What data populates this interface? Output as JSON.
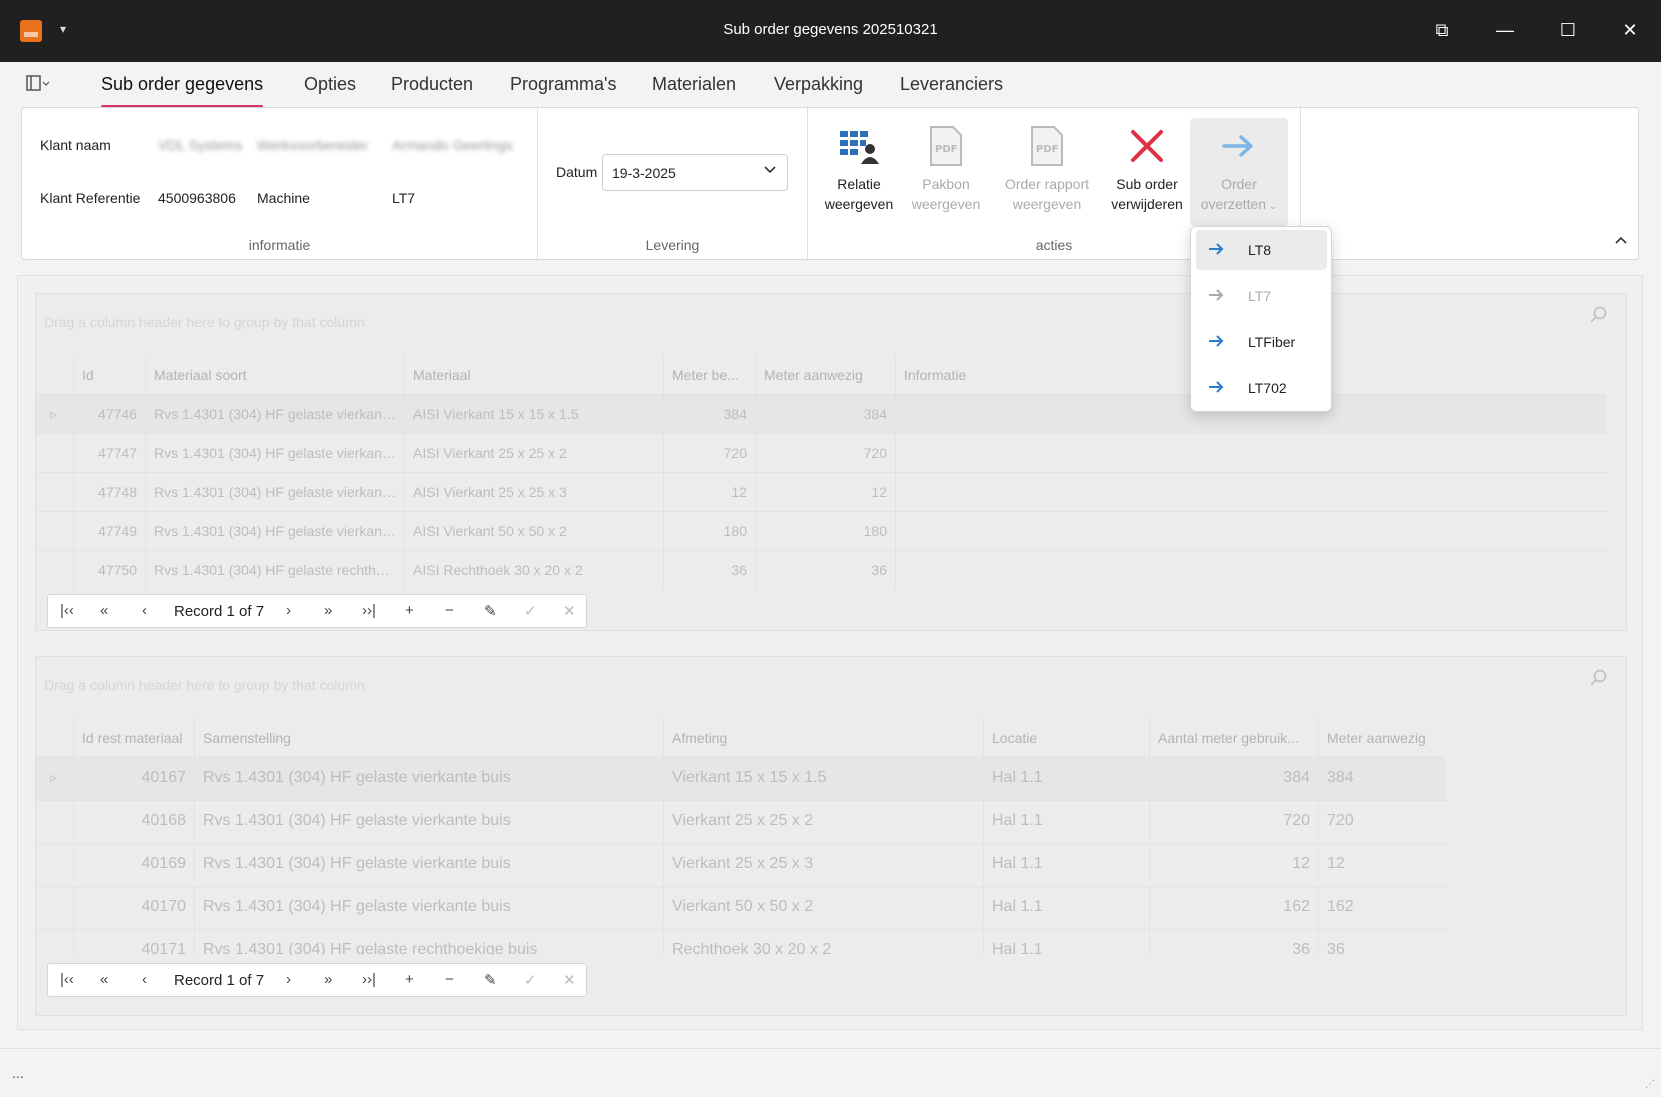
{
  "window": {
    "title": "Sub order gegevens 202510321",
    "quick_access": "▾",
    "btn_restore": "⧉",
    "btn_min": "—",
    "btn_max": "☐",
    "btn_close": "✕"
  },
  "tabs": [
    {
      "label": "Sub order gegevens"
    },
    {
      "label": "Opties"
    },
    {
      "label": "Producten"
    },
    {
      "label": "Programma's"
    },
    {
      "label": "Materialen"
    },
    {
      "label": "Verpakking"
    },
    {
      "label": "Leveranciers"
    }
  ],
  "ribbon": {
    "info": {
      "caption": "informatie",
      "klant_naam_label": "Klant naam",
      "klant_naam_blur1": "VDL Systems",
      "klant_naam_blur2": "Werkvoorbereider",
      "klant_naam_blur3": "Armando Geerlings",
      "klant_ref_label": "Klant Referentie",
      "klant_ref_value": "4500963806",
      "machine_label": "Machine",
      "machine_value": "LT7"
    },
    "levering": {
      "caption": "Levering",
      "datum_label": "Datum",
      "datum_value": "19-3-2025"
    },
    "acties": {
      "caption": "acties",
      "relatie": [
        "Relatie",
        "weergeven"
      ],
      "pakbon": [
        "Pakbon",
        "weergeven"
      ],
      "rapport": [
        "Order rapport",
        "weergeven"
      ],
      "verwijderen": [
        "Sub order",
        "verwijderen"
      ],
      "overzetten": [
        "Order",
        "overzetten"
      ]
    }
  },
  "dropdown": {
    "items": [
      {
        "label": "LT8"
      },
      {
        "label": "LT7"
      },
      {
        "label": "LTFiber"
      },
      {
        "label": "LT702"
      }
    ]
  },
  "grid1": {
    "group_hint": "Drag a column header here to group by that column",
    "columns": [
      "Id",
      "Materiaal soort",
      "Materiaal",
      "Meter be...",
      "Meter aanwezig",
      "Informatie"
    ],
    "rows": [
      [
        "47746",
        "Rvs 1.4301 (304) HF gelaste vierkante ...",
        "AISI Vierkant 15 x 15 x 1.5",
        "384",
        "384",
        ""
      ],
      [
        "47747",
        "Rvs 1.4301 (304) HF gelaste vierkante ...",
        "AISI Vierkant 25 x 25 x 2",
        "720",
        "720",
        ""
      ],
      [
        "47748",
        "Rvs 1.4301 (304) HF gelaste vierkante ...",
        "AISI Vierkant 25 x 25 x 3",
        "12",
        "12",
        ""
      ],
      [
        "47749",
        "Rvs 1.4301 (304) HF gelaste vierkante ...",
        "AISI Vierkant 50 x 50 x 2",
        "180",
        "180",
        ""
      ],
      [
        "47750",
        "Rvs 1.4301 (304) HF gelaste rechthoeki...",
        "AISI Rechthoek 30 x 20 x 2",
        "36",
        "36",
        ""
      ]
    ],
    "pager": "Record 1 of 7"
  },
  "grid2": {
    "group_hint": "Drag a column header here to group by that column",
    "columns": [
      "Id rest materiaal",
      "Samenstelling",
      "Afmeting",
      "Locatie",
      "Aantal meter gebruik...",
      "Meter aanwezig"
    ],
    "rows": [
      [
        "40167",
        "Rvs 1.4301 (304) HF gelaste vierkante buis",
        "Vierkant 15 x 15 x 1.5",
        "Hal 1.1",
        "384",
        "384"
      ],
      [
        "40168",
        "Rvs 1.4301 (304) HF gelaste vierkante buis",
        "Vierkant 25 x 25 x 2",
        "Hal 1.1",
        "720",
        "720"
      ],
      [
        "40169",
        "Rvs 1.4301 (304) HF gelaste vierkante buis",
        "Vierkant 25 x 25 x 3",
        "Hal 1.1",
        "12",
        "12"
      ],
      [
        "40170",
        "Rvs 1.4301 (304) HF gelaste vierkante buis",
        "Vierkant 50 x 50 x 2",
        "Hal 1.1",
        "162",
        "162"
      ],
      [
        "40171",
        "Rvs 1.4301 (304) HF gelaste rechthoekige buis",
        "Rechthoek 30 x 20 x 2",
        "Hal 1.1",
        "36",
        "36"
      ]
    ],
    "pager": "Record 1 of 7"
  },
  "status": {
    "text": "..."
  }
}
